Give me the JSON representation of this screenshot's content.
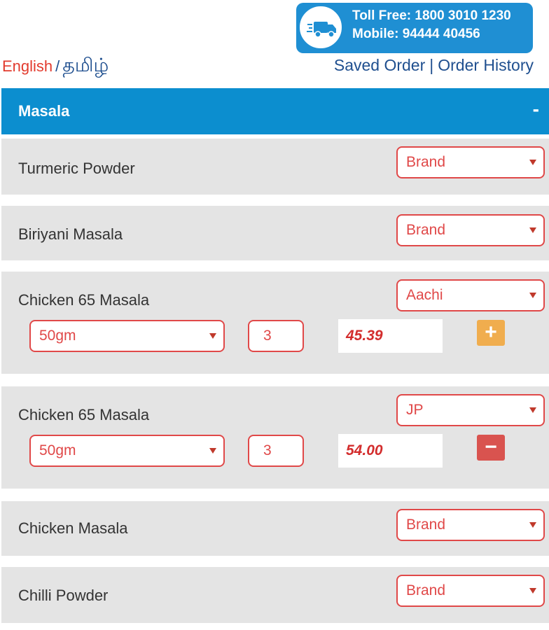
{
  "header": {
    "toll_free": "Toll Free: 1800 3010 1230",
    "mobile": "Mobile: 94444 40456",
    "icon": "delivery-truck-icon",
    "lang_english": "English",
    "lang_separator": "/",
    "lang_tamil": "தமிழ்",
    "link_saved_order": "Saved Order",
    "link_separator": "|",
    "link_order_history": "Order History"
  },
  "category": {
    "title": "Masala",
    "toggle": "-"
  },
  "products": [
    {
      "name": "Turmeric Powder",
      "brand": "Brand"
    },
    {
      "name": "Biriyani Masala",
      "brand": "Brand"
    },
    {
      "name": "Chicken 65 Masala",
      "brand": "Aachi",
      "unit": "50gm",
      "qty": "3",
      "price": "45.39",
      "action": "+"
    },
    {
      "name": "Chicken 65 Masala",
      "brand": "JP",
      "unit": "50gm",
      "qty": "3",
      "price": "54.00",
      "action": "−"
    },
    {
      "name": "Chicken Masala",
      "brand": "Brand"
    },
    {
      "name": "Chilli Powder",
      "brand": "Brand"
    }
  ],
  "colors": {
    "primary_blue": "#0c8ecf",
    "accent_red": "#e04848",
    "add_orange": "#f0ad4e",
    "remove_red": "#d9534f",
    "row_bg": "#e4e4e4"
  }
}
